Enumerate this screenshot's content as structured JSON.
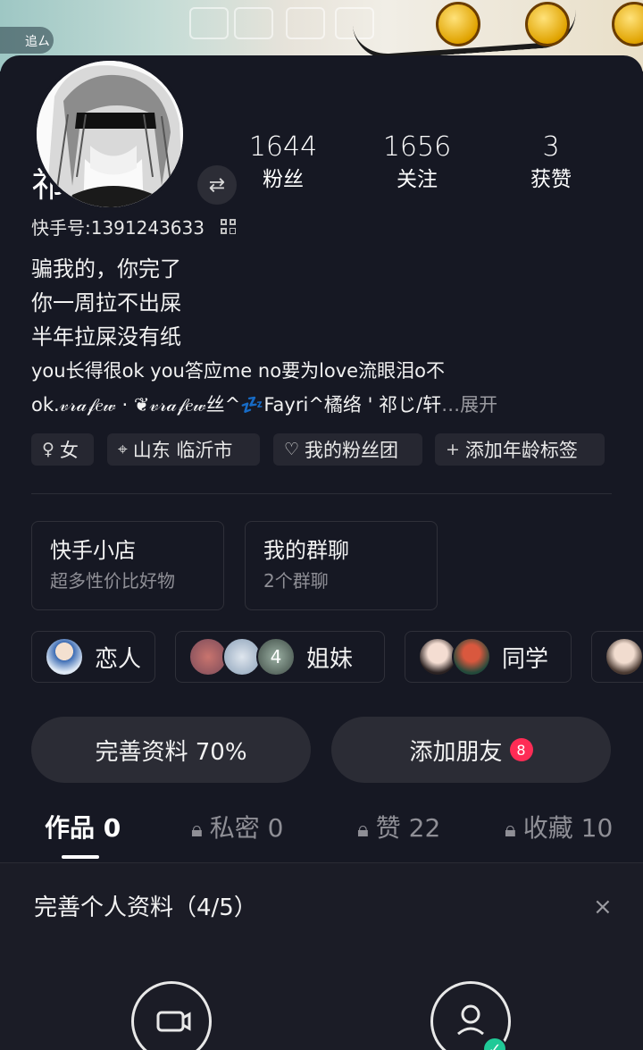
{
  "banner": {
    "chat_label": "追ㄙ"
  },
  "profile": {
    "name": "祁じ/轩.”",
    "kuaishou_id": "快手号:1391243633",
    "bio_lines": [
      "骗我的，你完了",
      "你一周拉不出屎",
      "半年拉屎没有纸",
      "you长得很ok you答应me no要为love流眼泪o不",
      "ok.𝓋𝓇𝒶𝒻𝑒𝓌 · ❦𝓋𝓇𝒶𝒻𝑒𝓌丝^",
      "Fayri^橘络 ' 祁じ/轩"
    ],
    "bio_zz": "💤",
    "bio_ellipsis": "…",
    "bio_more": "展开"
  },
  "stats": [
    {
      "value": "1644",
      "label": "粉丝"
    },
    {
      "value": "1656",
      "label": "关注"
    },
    {
      "value": "3",
      "label": "获赞"
    }
  ],
  "tags": [
    {
      "icon": "female-icon",
      "label": "女"
    },
    {
      "icon": "location-icon",
      "label": "山东 临沂市"
    },
    {
      "icon": "heart-icon",
      "label": "我的粉丝团"
    },
    {
      "icon": "plus-icon",
      "label": "添加年龄标签"
    }
  ],
  "cards": [
    {
      "title": "快手小店",
      "subtitle": "超多性价比好物"
    },
    {
      "title": "我的群聊",
      "subtitle": "2个群聊"
    }
  ],
  "groups": [
    {
      "label": "恋人"
    },
    {
      "label": "姐妹",
      "count": "4"
    },
    {
      "label": "同学"
    }
  ],
  "actions": {
    "edit_profile": "完善资料 70%",
    "add_friend": "添加朋友",
    "add_friend_badge": "8"
  },
  "tabs": [
    {
      "label": "作品 0",
      "locked": false
    },
    {
      "label": "私密 0",
      "locked": true
    },
    {
      "label": "赞 22",
      "locked": true
    },
    {
      "label": "收藏 10",
      "locked": true
    }
  ],
  "complete_profile": {
    "title": "完善个人资料（4/5）",
    "close": "×"
  },
  "colors": {
    "background": "#161823",
    "accent": "#fe2c55",
    "check": "#20c997"
  }
}
